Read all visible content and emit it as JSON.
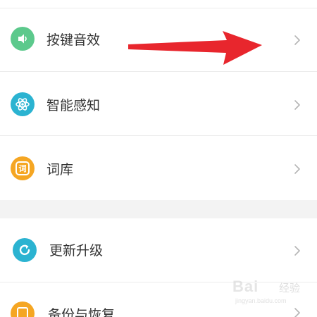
{
  "settings": {
    "items": [
      {
        "label": "按键音效",
        "icon": "speaker-icon",
        "icon_color": "#5cc98c"
      },
      {
        "label": "智能感知",
        "icon": "atom-icon",
        "icon_color": "#2bb3d1"
      },
      {
        "label": "词库",
        "icon": "dictionary-icon",
        "icon_color": "#f5a623",
        "icon_char": "词"
      },
      {
        "label": "更新升级",
        "icon": "refresh-icon",
        "icon_color": "#2bb3d1"
      },
      {
        "label": "备份与恢复",
        "icon": "backup-icon",
        "icon_color": "#f5a623"
      }
    ]
  },
  "annotation": {
    "arrow_color": "#e8262d"
  },
  "watermark": {
    "brand": "Bai",
    "brand2": "经验",
    "domain": "jingyan.baidu.com"
  }
}
